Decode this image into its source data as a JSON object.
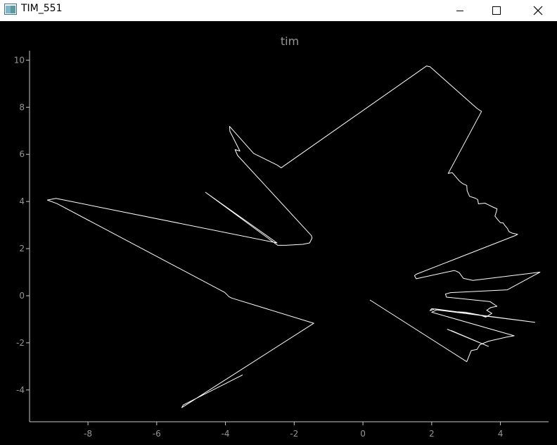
{
  "window": {
    "title": "TIM_551",
    "icons": {
      "app": "app-window-icon",
      "minimize": "minimize-icon",
      "maximize": "maximize-icon",
      "close": "close-icon"
    }
  },
  "colors": {
    "background": "#000000",
    "axis": "#c8c8c8",
    "tick_label": "#969696",
    "title": "#969696",
    "trace": "#ffffff",
    "titlebar": "#ffffff"
  },
  "chart_data": {
    "type": "line",
    "title": "tim",
    "xlabel": "",
    "ylabel": "",
    "xlim": [
      -9.7,
      5.4
    ],
    "ylim": [
      -5.35,
      10.4
    ],
    "xticks": [
      -8,
      -6,
      -4,
      -2,
      0,
      2,
      4
    ],
    "yticks": [
      -4,
      -2,
      0,
      2,
      4,
      6,
      8,
      10
    ],
    "xtick_labels": [
      "-8",
      "-6",
      "-4",
      "-2",
      "0",
      "2",
      "4"
    ],
    "ytick_labels": [
      "-4",
      "-2",
      "0",
      "2",
      "4",
      "6",
      "8",
      "10"
    ],
    "grid": false,
    "series": [
      {
        "values_xy": [
          [
            -3.5,
            -3.36
          ],
          [
            -5.23,
            -4.64
          ],
          [
            -5.27,
            -4.75
          ],
          [
            -1.43,
            -1.17
          ],
          [
            -3.82,
            -0.1
          ],
          [
            -3.9,
            -0.04
          ],
          [
            -4.02,
            0.14
          ],
          [
            -8.9,
            3.91
          ],
          [
            -9.18,
            4.06
          ],
          [
            -8.93,
            4.13
          ],
          [
            -2.5,
            2.24
          ],
          [
            -4.58,
            4.39
          ],
          [
            -2.48,
            2.14
          ],
          [
            -2.25,
            2.14
          ],
          [
            -1.75,
            2.18
          ],
          [
            -1.55,
            2.24
          ],
          [
            -1.48,
            2.45
          ],
          [
            -1.5,
            2.55
          ],
          [
            -3.65,
            5.96
          ],
          [
            -3.72,
            6.2
          ],
          [
            -3.58,
            6.14
          ],
          [
            -3.87,
            6.98
          ],
          [
            -3.88,
            7.19
          ],
          [
            -3.18,
            6.04
          ],
          [
            -2.5,
            5.55
          ],
          [
            -2.38,
            5.43
          ],
          [
            1.85,
            9.75
          ],
          [
            1.95,
            9.72
          ],
          [
            3.32,
            7.95
          ],
          [
            3.45,
            7.82
          ],
          [
            2.48,
            5.19
          ],
          [
            2.6,
            5.22
          ],
          [
            2.8,
            4.88
          ],
          [
            2.9,
            4.76
          ],
          [
            3.02,
            4.68
          ],
          [
            3.03,
            4.46
          ],
          [
            3.1,
            4.22
          ],
          [
            3.27,
            4.14
          ],
          [
            3.34,
            4.08
          ],
          [
            3.36,
            3.9
          ],
          [
            3.55,
            3.93
          ],
          [
            3.62,
            3.88
          ],
          [
            3.8,
            3.75
          ],
          [
            3.9,
            3.69
          ],
          [
            3.88,
            3.56
          ],
          [
            3.84,
            3.38
          ],
          [
            3.92,
            3.23
          ],
          [
            4.0,
            3.1
          ],
          [
            4.08,
            3.09
          ],
          [
            4.12,
            3.0
          ],
          [
            4.2,
            2.86
          ],
          [
            4.25,
            2.72
          ],
          [
            4.35,
            2.65
          ],
          [
            4.5,
            2.61
          ],
          [
            4.46,
            2.57
          ],
          [
            1.55,
            0.91
          ],
          [
            1.5,
            0.85
          ],
          [
            1.55,
            0.72
          ],
          [
            2.65,
            1.07
          ],
          [
            2.72,
            1.04
          ],
          [
            2.8,
            0.98
          ],
          [
            2.92,
            0.74
          ],
          [
            3.2,
            0.65
          ],
          [
            5.15,
            1.0
          ],
          [
            4.2,
            0.25
          ],
          [
            2.55,
            0.13
          ],
          [
            2.4,
            0.07
          ],
          [
            2.43,
            -0.06
          ],
          [
            3.7,
            -0.25
          ],
          [
            3.9,
            -0.45
          ],
          [
            3.72,
            -0.5
          ],
          [
            3.6,
            -0.62
          ],
          [
            3.75,
            -0.75
          ],
          [
            3.57,
            -0.91
          ],
          [
            3.4,
            -0.82
          ],
          [
            2.97,
            -0.7
          ],
          [
            2.72,
            -0.68
          ],
          [
            2.1,
            -0.56
          ],
          [
            1.95,
            -0.63
          ],
          [
            2.0,
            -0.55
          ],
          [
            5.0,
            -1.13
          ],
          [
            2.15,
            -0.6
          ],
          [
            2.0,
            -0.7
          ],
          [
            4.4,
            -1.7
          ],
          [
            4.2,
            -1.75
          ],
          [
            3.65,
            -1.93
          ],
          [
            3.4,
            -2.08
          ],
          [
            3.32,
            -2.28
          ],
          [
            3.15,
            -2.33
          ],
          [
            3.02,
            -2.8
          ],
          [
            0.2,
            -0.18
          ]
        ]
      },
      {
        "values_xy": [
          [
            2.45,
            -1.42
          ],
          [
            3.65,
            -2.15
          ],
          [
            2.57,
            -1.48
          ]
        ]
      }
    ]
  }
}
